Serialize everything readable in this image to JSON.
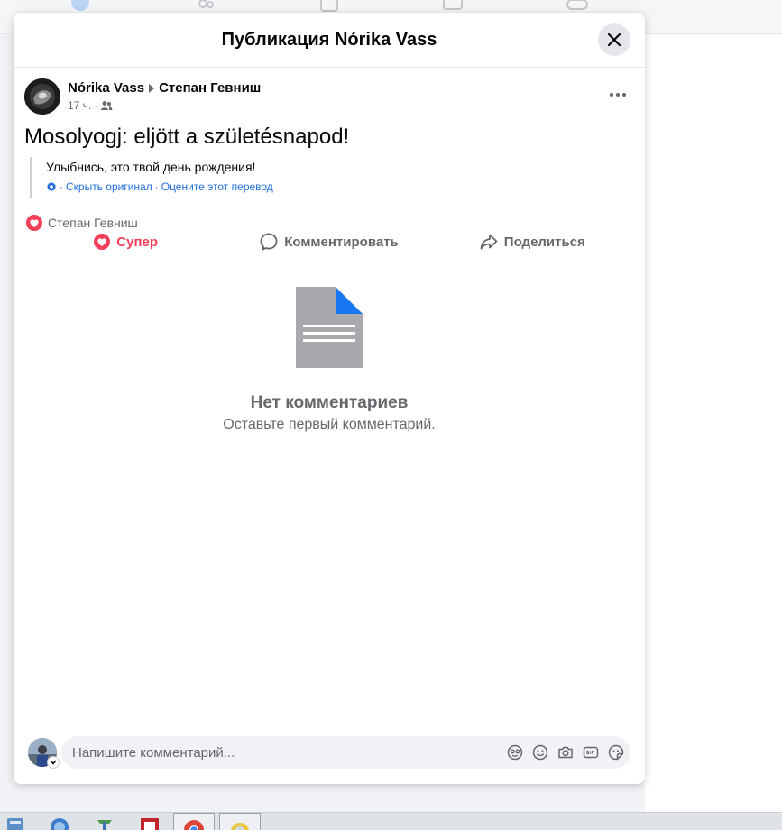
{
  "modal": {
    "title": "Публикация Nórika Vass",
    "close_icon": "close-icon"
  },
  "post": {
    "author": "Nórika Vass",
    "recipient": "Степан Гевниш",
    "time": "17 ч.",
    "time_separator": "·",
    "audience_icon": "friends-icon",
    "text": "Mosolyogj: eljött a születésnapod!",
    "translation": {
      "text": "Улыбнись, это твой день рождения!",
      "separator": "·",
      "hide_original": "Скрыть оригинал",
      "rate_translation": "Оцените этот перевод"
    },
    "reactions": {
      "icon": "love-reaction-icon",
      "names": "Степан Гевниш"
    }
  },
  "actions": {
    "super": "Супер",
    "comment": "Комментировать",
    "share": "Поделиться"
  },
  "empty_state": {
    "title": "Нет комментариев",
    "subtitle": "Оставьте первый комментарий."
  },
  "composer": {
    "placeholder": "Напишите комментарий...",
    "tools": [
      "avatar-sticker-icon",
      "emoji-icon",
      "camera-icon",
      "gif-icon",
      "sticker-icon"
    ]
  },
  "colors": {
    "love": "#f33e58",
    "link": "#216fdb",
    "secondary_text": "#65676b",
    "doc_icon": "#a8a9ad",
    "doc_corner": "#1877f2"
  }
}
